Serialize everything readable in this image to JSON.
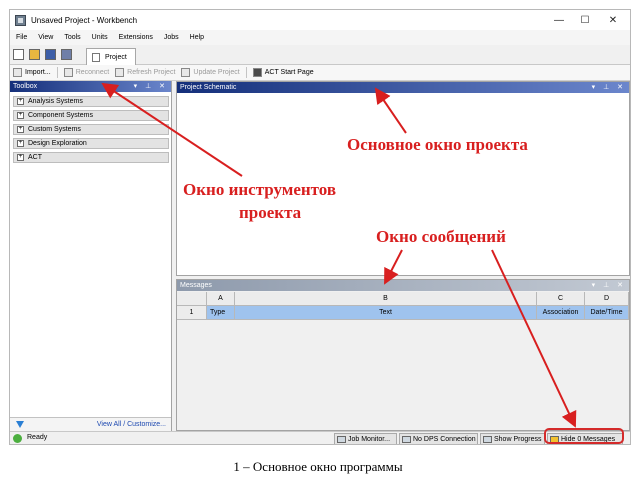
{
  "window": {
    "title": "Unsaved Project - Workbench",
    "controls": {
      "minimize": "—",
      "maximize": "☐",
      "close": "✕"
    }
  },
  "menu": [
    "File",
    "View",
    "Tools",
    "Units",
    "Extensions",
    "Jobs",
    "Help"
  ],
  "quick_access_icons": [
    "new-icon",
    "open-icon",
    "save-icon",
    "save-as-icon"
  ],
  "tabs": [
    {
      "label": "Project",
      "active": true
    }
  ],
  "toolbar": {
    "import": "Import...",
    "reconnect": "Reconnect",
    "refresh": "Refresh Project",
    "update": "Update Project",
    "act_start": "ACT Start Page"
  },
  "pane_controls": "▾ ⊥ ✕",
  "toolbox": {
    "title": "Toolbox",
    "items": [
      "Analysis Systems",
      "Component Systems",
      "Custom Systems",
      "Design Exploration",
      "ACT"
    ],
    "footer_link": "View All / Customize..."
  },
  "schematic": {
    "title": "Project Schematic"
  },
  "messages": {
    "title": "Messages",
    "column_letters": [
      "A",
      "B",
      "C",
      "D"
    ],
    "row": {
      "number": "1",
      "type": "Type",
      "text": "Text",
      "association": "Association",
      "datetime": "Date/Time"
    }
  },
  "status": {
    "ready": "Ready",
    "job_monitor": "Job Monitor...",
    "dps": "No DPS Connection",
    "show_progress": "Show Progress",
    "hide_messages": "Hide 0 Messages"
  },
  "annotations": {
    "main_window": "Основное окно проекта",
    "tools_line1": "Окно инструментов",
    "tools_line2": "проекта",
    "messages_window": "Окно сообщений",
    "color": "#d81f1f"
  },
  "caption": "1 – Основное окно программы"
}
